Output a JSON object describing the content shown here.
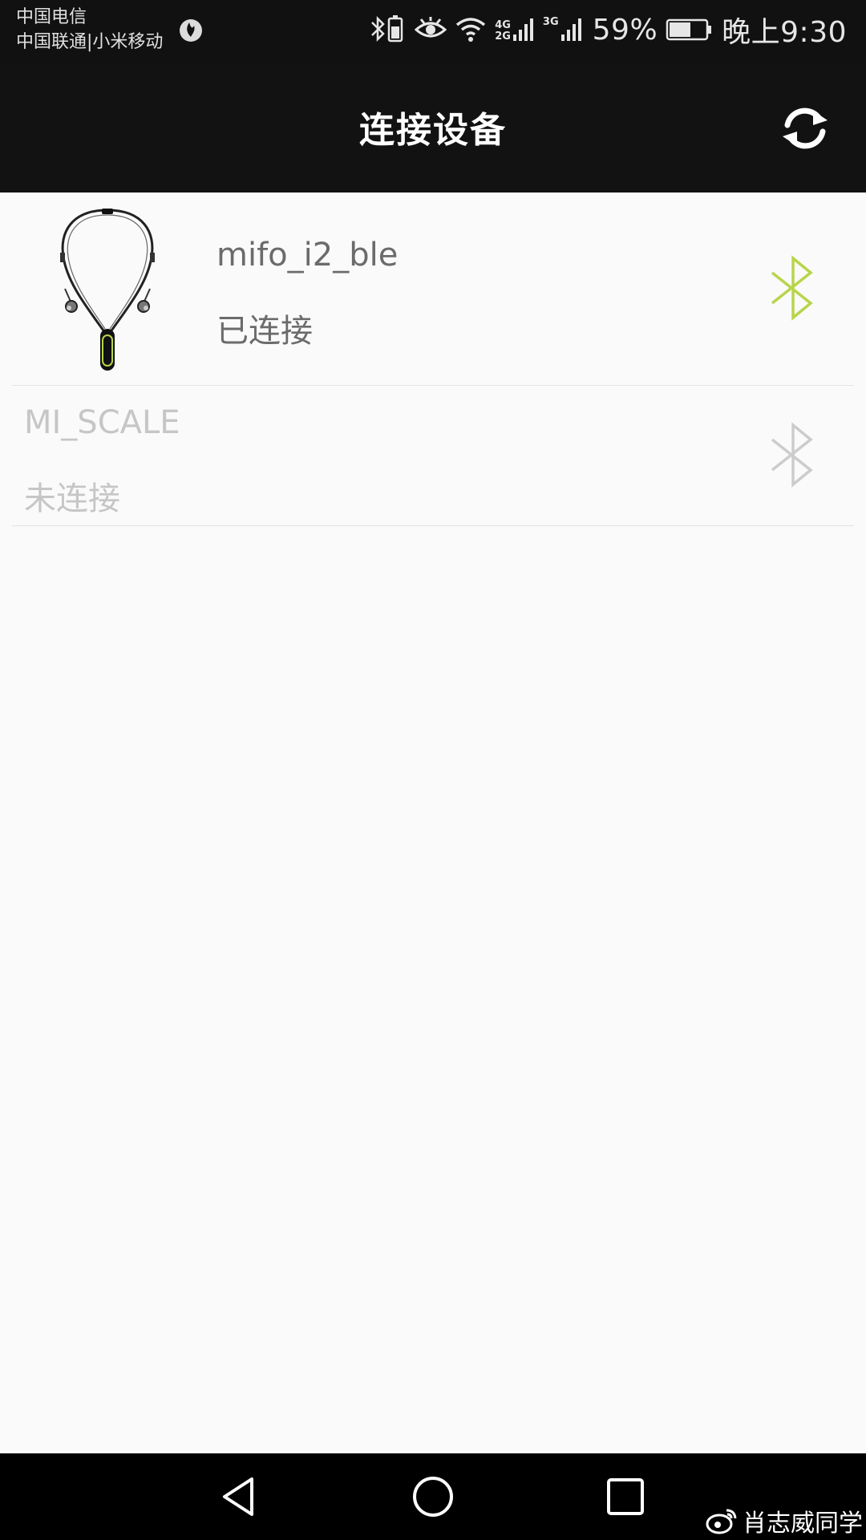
{
  "status_bar": {
    "carrier_1": "中国电信",
    "carrier_2": "中国联通|小米移动",
    "network_1_top": "4G",
    "network_1_bottom": "2G",
    "network_2": "3G",
    "battery_percent": "59%",
    "battery_level": 0.59,
    "time": "晚上9:30"
  },
  "app_bar": {
    "title": "连接设备",
    "refresh_icon": "refresh-icon"
  },
  "devices": [
    {
      "name": "mifo_i2_ble",
      "status": "已连接",
      "connected": true,
      "bt_color": "#b7d54a",
      "image": "neckband-earphones"
    },
    {
      "name": "MI_SCALE",
      "status": "未连接",
      "connected": false,
      "bt_color": "#cccccc"
    }
  ],
  "nav_bar": {
    "back_icon": "back-icon",
    "home_icon": "home-icon",
    "recents_icon": "recents-icon"
  },
  "watermark": {
    "text": "肖志威同学",
    "icon": "weibo-icon"
  }
}
